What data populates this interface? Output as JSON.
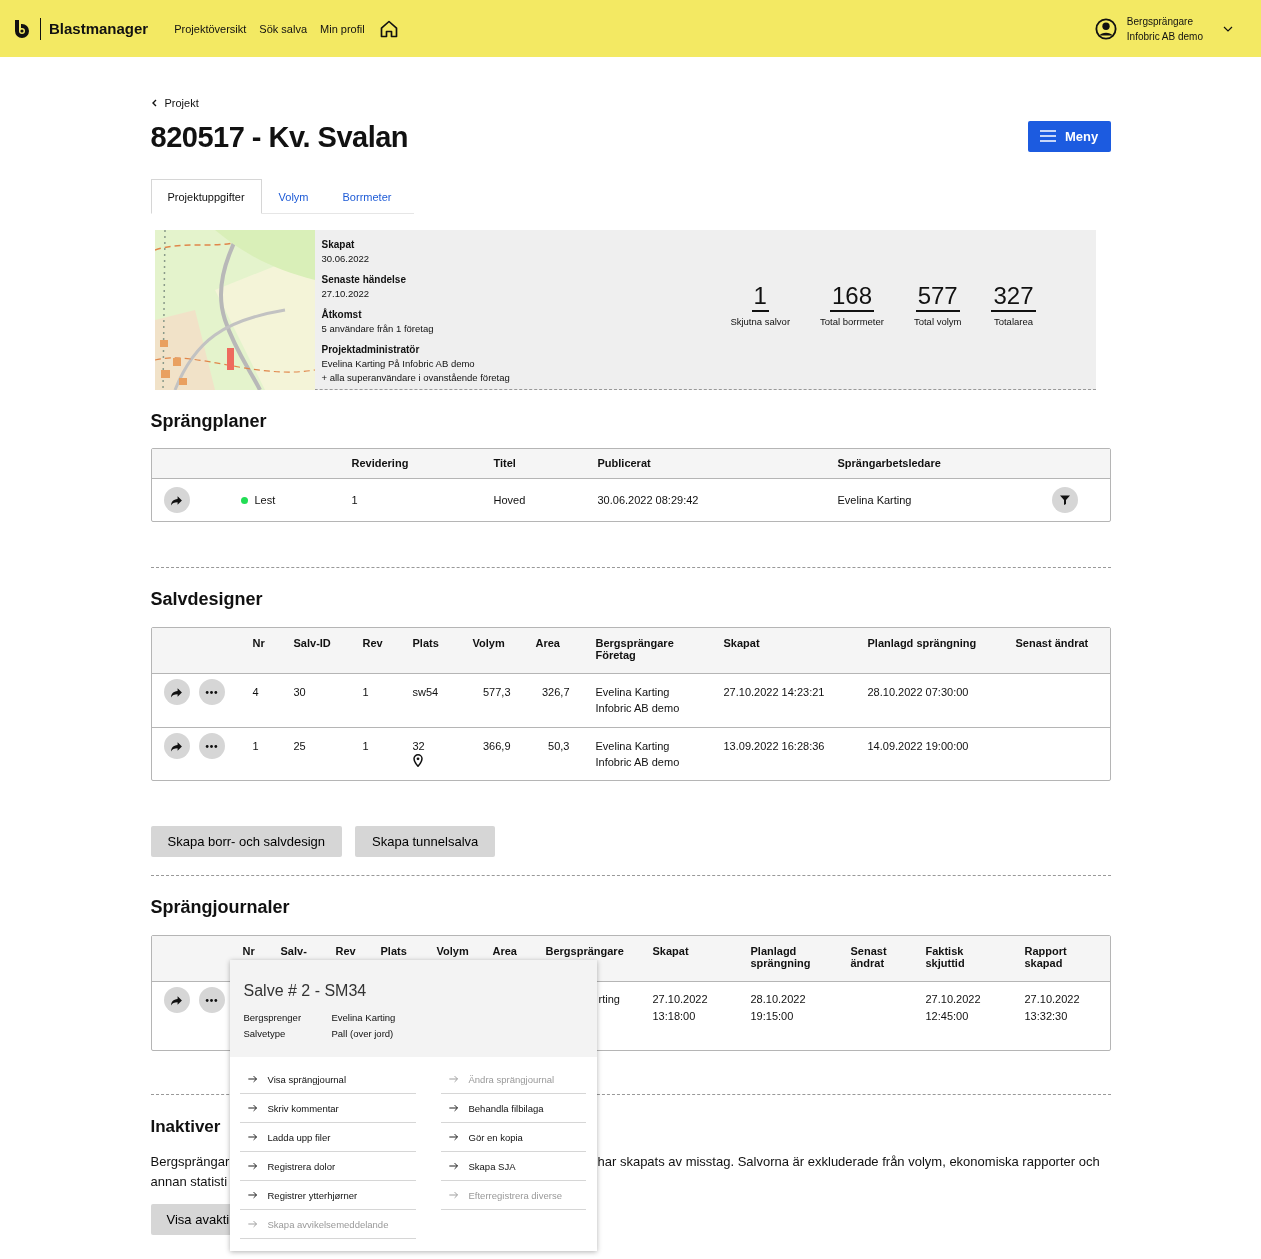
{
  "header": {
    "brand": "Blastmanager",
    "nav": [
      {
        "label": "Projektöversikt"
      },
      {
        "label": "Sök salva"
      },
      {
        "label": "Min profil"
      }
    ],
    "user": {
      "role": "Bergsprängare",
      "company": "Infobric AB demo"
    }
  },
  "breadcrumb": "Projekt",
  "title": "820517 - Kv. Svalan",
  "menu_button": "Meny",
  "tabs": [
    {
      "label": "Projektuppgifter",
      "selected": true
    },
    {
      "label": "Volym",
      "selected": false
    },
    {
      "label": "Borrmeter",
      "selected": false
    }
  ],
  "info": {
    "details": [
      {
        "label": "Skapat",
        "lines": [
          "30.06.2022"
        ]
      },
      {
        "label": "Senaste händelse",
        "lines": [
          "27.10.2022"
        ]
      },
      {
        "label": "Åtkomst",
        "lines": [
          "5 användare från 1 företag"
        ]
      },
      {
        "label": "Projektadministratör",
        "lines": [
          "Evelina Karting På Infobric AB demo",
          "+ alla superanvändare i ovanstående företag"
        ]
      }
    ],
    "stats": [
      {
        "value": "1",
        "label": "Skjutna salvor"
      },
      {
        "value": "168",
        "label": "Total borrmeter"
      },
      {
        "value": "577",
        "label": "Total volym"
      },
      {
        "value": "327",
        "label": "Totalarea"
      }
    ]
  },
  "blast_plans": {
    "title": "Sprängplaner",
    "columns": [
      "Revidering",
      "Titel",
      "Publicerat",
      "Sprängarbetsledare"
    ],
    "rows": [
      {
        "status": "Lest",
        "color": "#22dd55",
        "cells": [
          "1",
          "Hoved",
          "30.06.2022 08:29:42",
          "Evelina Karting"
        ]
      }
    ]
  },
  "salvo_designs": {
    "title": "Salvdesigner",
    "columns": [
      "Nr",
      "Salv-ID",
      "Rev",
      "Plats",
      "Volym",
      "Area",
      "Bergsprängare\nFöretag",
      "Skapat",
      "Planlagd sprängning",
      "Senast ändrat"
    ],
    "rows": [
      {
        "location": false,
        "cells": [
          "4",
          "30",
          "1",
          "sw54",
          "577,3",
          "326,7",
          "Evelina Karting\nInfobric AB demo",
          "27.10.2022 14:23:21",
          "28.10.2022 07:30:00",
          null
        ]
      },
      {
        "location": true,
        "cells": [
          "1",
          "25",
          "1",
          "32",
          "366,9",
          "50,3",
          "Evelina Karting\nInfobric AB demo",
          "13.09.2022 16:28:36",
          "14.09.2022 19:00:00",
          null
        ]
      }
    ]
  },
  "design_buttons": [
    "Skapa borr- och salvdesign",
    "Skapa tunnelsalva"
  ],
  "journals": {
    "title": "Sprängjournaler",
    "columns": [
      "Nr",
      "Salv-",
      "Rev",
      "Plats",
      "Volym",
      "Area",
      "Bergsprängare",
      "Skapat",
      "Planlagd\nsprängning",
      "Senast\nändrat",
      "Faktisk\nskjuttid",
      "Rapport\nskapad"
    ],
    "rows": [
      {
        "cells": [
          null,
          null,
          null,
          null,
          null,
          null,
          "rting",
          "27.10.2022\n13:18:00",
          "28.10.2022\n19:15:00",
          null,
          "27.10.2022\n12:45:00",
          "27.10.2022\n13:32:30"
        ]
      }
    ]
  },
  "popup": {
    "title": "Salve # 2 - SM34",
    "fields": [
      {
        "label": "Bergsprenger",
        "value": "Evelina Karting"
      },
      {
        "label": "Salvetype",
        "value": "Pall (over jord)"
      }
    ],
    "action_columns": [
      {
        "actions": [
          {
            "label": "Visa sprängjournal",
            "disabled": false
          },
          {
            "label": "Skriv kommentar",
            "disabled": false
          },
          {
            "label": "Ladda upp filer",
            "disabled": false
          },
          {
            "label": "Registrera dolor",
            "disabled": false
          },
          {
            "label": "Registrer ytterhjørner",
            "disabled": false
          },
          {
            "label": "Skapa avvikelsemeddelande",
            "disabled": true
          }
        ]
      },
      {
        "actions": [
          {
            "label": "Ändra sprängjournal",
            "disabled": true
          },
          {
            "label": "Behandla filbilaga",
            "disabled": false
          },
          {
            "label": "Gör en kopia",
            "disabled": false
          },
          {
            "label": "Skapa SJA",
            "disabled": false
          },
          {
            "label": "Efterregistrera diverse",
            "disabled": true
          }
        ]
      }
    ]
  },
  "inactive": {
    "title": "Inaktiver",
    "text_left": [
      "Bergsprängar",
      "annan statisti"
    ],
    "text_right": "har skapats av misstag. Salvorna är exkluderade från volym, ekonomiska rapporter och",
    "button": "Visa avakti"
  }
}
